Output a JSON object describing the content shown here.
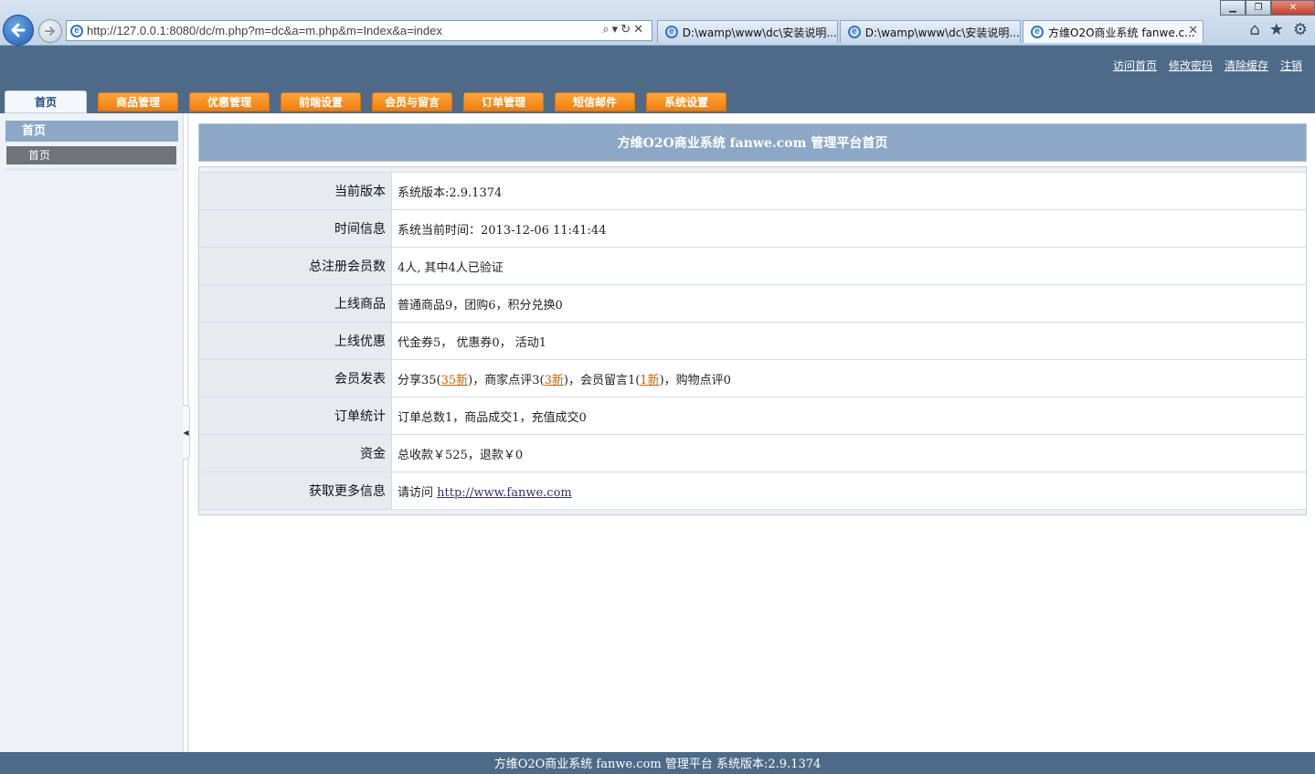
{
  "browser": {
    "url": "http://127.0.0.1:8080/dc/m.php?m=dc&a=m.php&m=Index&a=index",
    "tabs": [
      {
        "label": "D:\\wamp\\www\\dc\\安装说明...."
      },
      {
        "label": "D:\\wamp\\www\\dc\\安装说明...."
      },
      {
        "label": "方维O2O商业系统 fanwe.c..."
      }
    ],
    "icons": [
      "back-icon",
      "forward-icon",
      "search-icon",
      "refresh-icon",
      "stop-icon",
      "home-icon",
      "favorites-star-icon",
      "tools-gear-icon"
    ]
  },
  "header": {
    "links": [
      "访问首页",
      "修改密码",
      "清除缓存",
      "注销"
    ]
  },
  "nav": {
    "tabs": [
      "首页",
      "商品管理",
      "优惠管理",
      "前端设置",
      "会员与留言",
      "订单管理",
      "短信邮件",
      "系统设置"
    ]
  },
  "sidebar": {
    "title": "首页",
    "item": "首页"
  },
  "main": {
    "title": "方维O2O商业系统 fanwe.com 管理平台首页",
    "rows": {
      "version": {
        "label": "当前版本",
        "value": "系统版本:2.9.1374"
      },
      "time": {
        "label": "时间信息",
        "value": "系统当前时间：2013-12-06 11:41:44"
      },
      "members": {
        "label": "总注册会员数",
        "value": "4人, 其中4人已验证"
      },
      "goods": {
        "label": "上线商品",
        "value": "普通商品9，团购6，积分兑换0"
      },
      "promo": {
        "label": "上线优惠",
        "value": "代金券5， 优惠券0， 活动1"
      },
      "posts": {
        "label": "会员发表",
        "share": "分享35(",
        "share_new": "35新",
        "review": ")，商家点评3(",
        "review_new": "3新",
        "message": ")，会员留言1(",
        "message_new": "1新",
        "shop_review": ")，购物点评0"
      },
      "orders": {
        "label": "订单统计",
        "value": "订单总数1，商品成交1，充值成交0"
      },
      "funds": {
        "label": "资金",
        "value": "总收款￥525，退款￥0"
      },
      "more": {
        "label": "获取更多信息",
        "prefix": "请访问 ",
        "link": "http://www.fanwe.com"
      }
    }
  },
  "footer": {
    "text": "方维O2O商业系统 fanwe.com 管理平台 系统版本:2.9.1374"
  }
}
